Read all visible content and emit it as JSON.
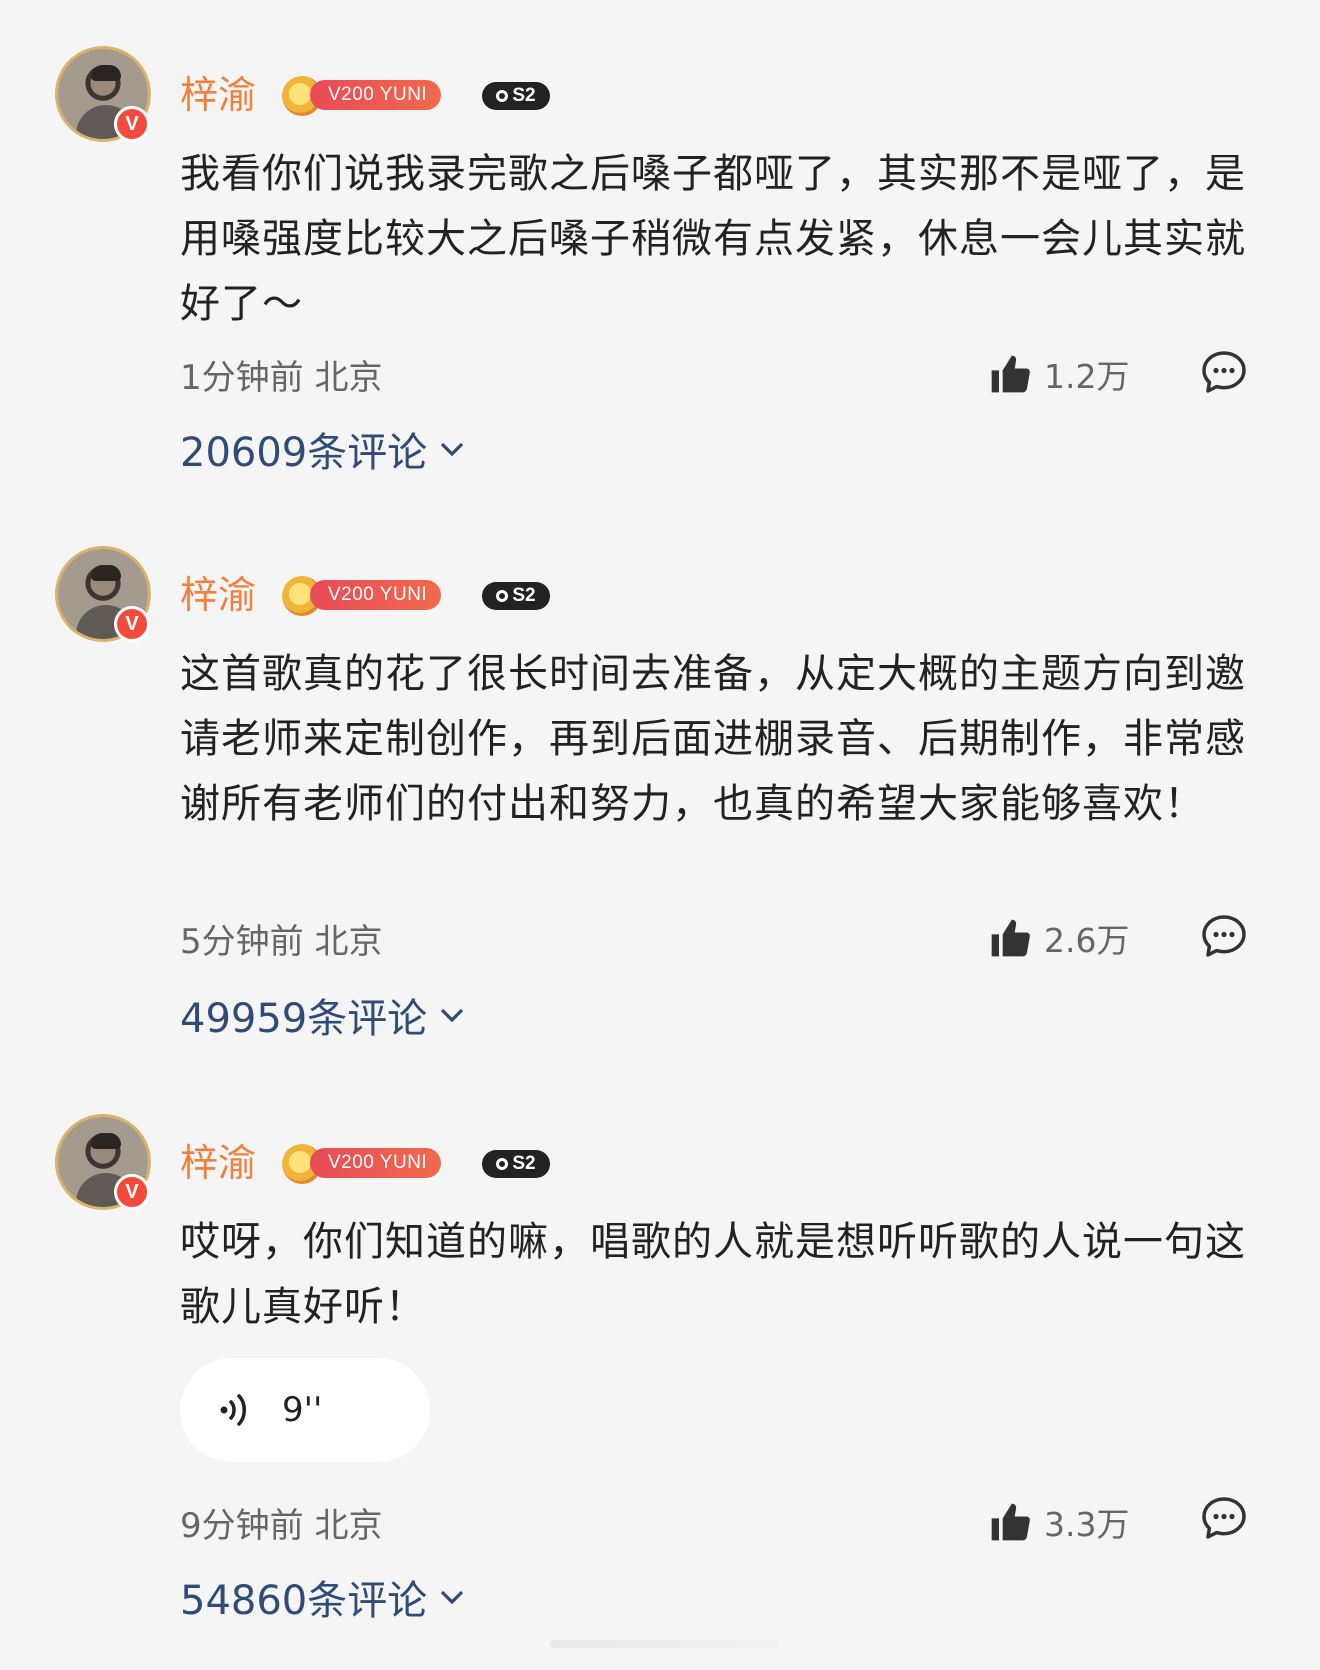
{
  "comments": [
    {
      "username": "梓渝",
      "vip_label": "V200 YUNI",
      "season_label": "S2",
      "text": "我看你们说我录完歌之后嗓子都哑了，其实那不是哑了，是用嗓强度比较大之后嗓子稍微有点发紧，休息一会儿其实就好了～",
      "time": "1分钟前",
      "location": "北京",
      "likes": "1.2万",
      "reply_count": "20609条评论"
    },
    {
      "username": "梓渝",
      "vip_label": "V200 YUNI",
      "season_label": "S2",
      "text": "这首歌真的花了很长时间去准备，从定大概的主题方向到邀请老师来定制创作，再到后面进棚录音、后期制作，非常感谢所有老师们的付出和努力，也真的希望大家能够喜欢！",
      "time": "5分钟前",
      "location": "北京",
      "likes": "2.6万",
      "reply_count": "49959条评论"
    },
    {
      "username": "梓渝",
      "vip_label": "V200 YUNI",
      "season_label": "S2",
      "text": "哎呀，你们知道的嘛，唱歌的人就是想听听歌的人说一句这歌儿真好听！",
      "voice_duration": "9''",
      "time": "9分钟前",
      "location": "北京",
      "likes": "3.3万",
      "reply_count": "54860条评论"
    }
  ],
  "icons": {
    "avatar_badge": "V",
    "like": "thumbs-up-icon",
    "reply": "comment-bubble-icon",
    "expand": "chevron-down-icon",
    "voice": "voice-wave-icon"
  },
  "colors": {
    "username": "#f1803d",
    "link": "#2f4b76",
    "vip_tag": "#e84a56",
    "verified_badge": "#f34a3c"
  }
}
